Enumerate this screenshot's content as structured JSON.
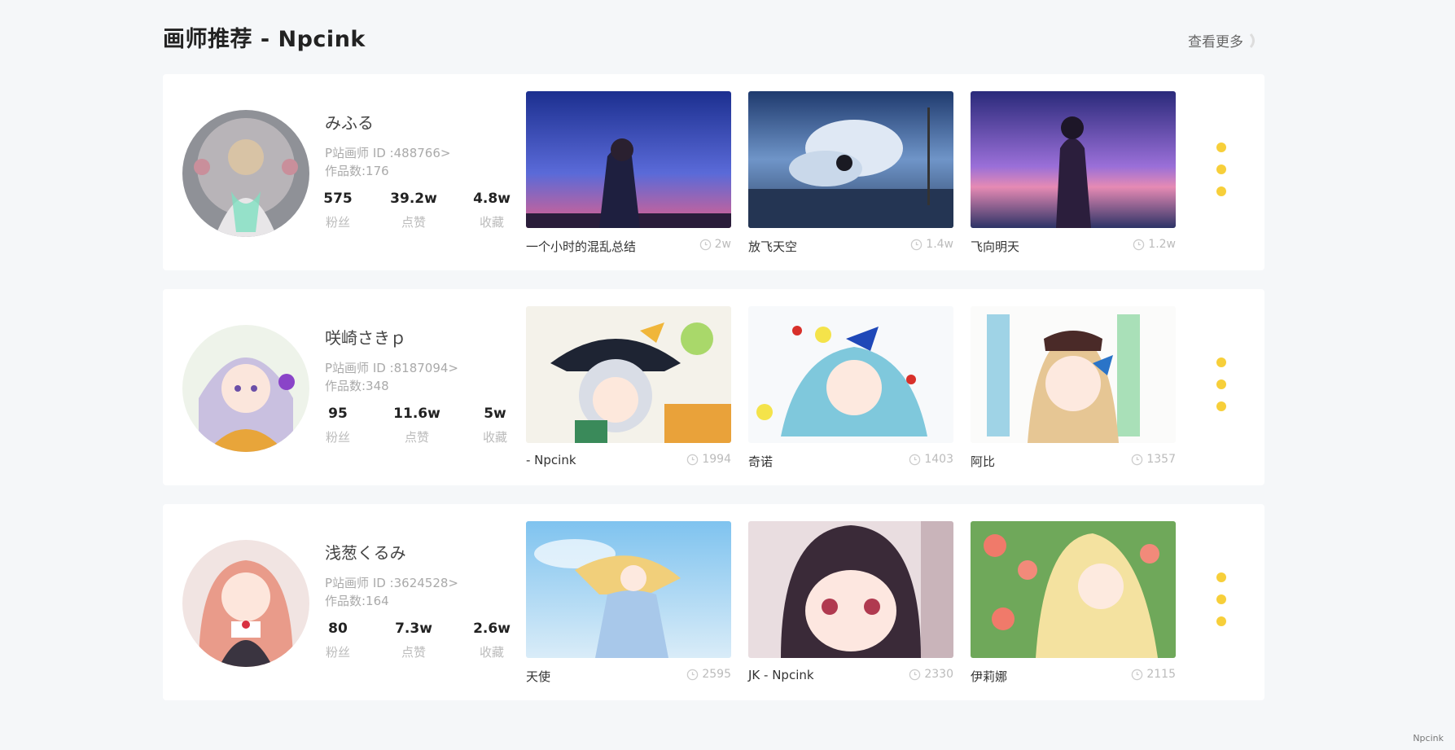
{
  "header": {
    "title": "画师推荐 - Npcink",
    "more_label": "查看更多"
  },
  "stat_labels": {
    "fans": "粉丝",
    "likes": "点赞",
    "collects": "收藏"
  },
  "artists": [
    {
      "name": "みふる",
      "pid": "P站画师 ID :488766>",
      "works": "作品数:176",
      "fans": "575",
      "likes": "39.2w",
      "collects": "4.8w",
      "works_list": [
        {
          "title": "一个小时的混乱总结",
          "views": "2w"
        },
        {
          "title": "放飞天空",
          "views": "1.4w"
        },
        {
          "title": "飞向明天",
          "views": "1.2w"
        }
      ]
    },
    {
      "name": "咲崎さきｐ",
      "pid": "P站画师 ID :8187094>",
      "works": "作品数:348",
      "fans": "95",
      "likes": "11.6w",
      "collects": "5w",
      "works_list": [
        {
          "title": "- Npcink",
          "views": "1994"
        },
        {
          "title": "奇诺",
          "views": "1403"
        },
        {
          "title": "阿比",
          "views": "1357"
        }
      ]
    },
    {
      "name": "浅葱くるみ",
      "pid": "P站画师 ID :3624528>",
      "works": "作品数:164",
      "fans": "80",
      "likes": "7.3w",
      "collects": "2.6w",
      "works_list": [
        {
          "title": "天使",
          "views": "2595"
        },
        {
          "title": "JK - Npcink",
          "views": "2330"
        },
        {
          "title": "伊莉娜",
          "views": "2115"
        }
      ]
    }
  ],
  "footer": {
    "brand": "Npcink"
  },
  "colors": {
    "accent_dot": "#f7cf3a",
    "card_bg": "#ffffff",
    "page_bg": "#f5f7f9"
  }
}
